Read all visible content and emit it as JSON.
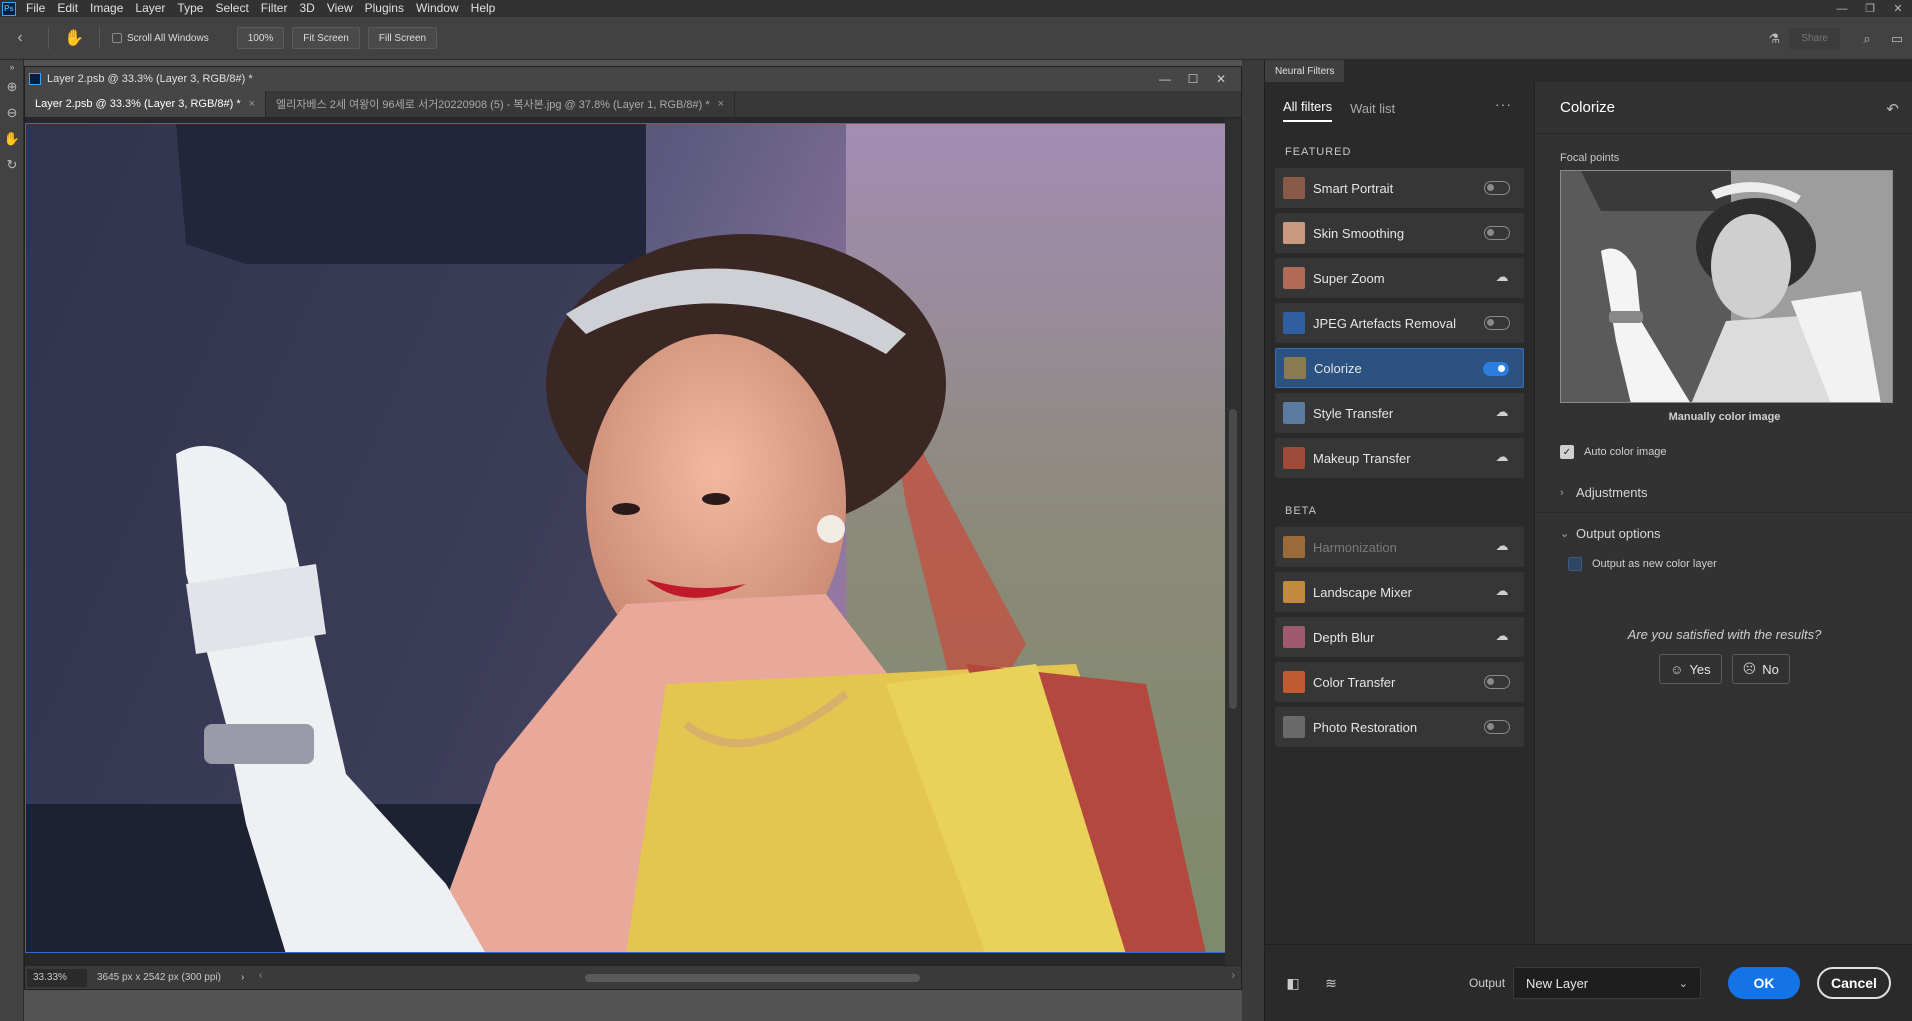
{
  "app": {
    "logo": "Ps",
    "menu": [
      "File",
      "Edit",
      "Image",
      "Layer",
      "Type",
      "Select",
      "Filter",
      "3D",
      "View",
      "Plugins",
      "Window",
      "Help"
    ]
  },
  "options_bar": {
    "scroll_all_windows": "Scroll All Windows",
    "zoom_100": "100%",
    "fit_screen": "Fit Screen",
    "fill_screen": "Fill Screen",
    "share": "Share"
  },
  "document": {
    "window_title": "Layer 2.psb @ 33.3% (Layer 3, RGB/8#) *",
    "tabs": [
      {
        "label": "Layer 2.psb @ 33.3% (Layer 3, RGB/8#) *",
        "close": "×"
      },
      {
        "label": "엘리자베스 2세 여왕이 96세로 서거20220908 (5) - 복사본.jpg @ 37.8% (Layer 1, RGB/8#) *",
        "close": "×"
      }
    ],
    "status_zoom": "33.33%",
    "status_dims": "3645 px x 2542 px (300 ppi)",
    "status_arrow": "›",
    "hscroll_left": "‹",
    "hscroll_right": "›"
  },
  "neural_filters": {
    "panel_tab": "Neural Filters",
    "list_tabs": {
      "all": "All filters",
      "wait": "Wait list"
    },
    "more": "···",
    "featured_title": "FEATURED",
    "beta_title": "BETA",
    "featured": [
      {
        "name": "Smart Portrait",
        "state": "off",
        "thumb": "#8a5a48"
      },
      {
        "name": "Skin Smoothing",
        "state": "off",
        "thumb": "#c99a80"
      },
      {
        "name": "Super Zoom",
        "state": "cloud",
        "thumb": "#b06a55"
      },
      {
        "name": "JPEG Artefacts Removal",
        "state": "off",
        "thumb": "#2f5fa0"
      },
      {
        "name": "Colorize",
        "state": "on",
        "thumb": "#8a7a50"
      },
      {
        "name": "Style Transfer",
        "state": "cloud",
        "thumb": "#5a7aa0"
      },
      {
        "name": "Makeup Transfer",
        "state": "cloud",
        "thumb": "#a04a3a"
      }
    ],
    "beta": [
      {
        "name": "Harmonization",
        "state": "cloud",
        "thumb": "#9a6a3a",
        "disabled": true
      },
      {
        "name": "Landscape Mixer",
        "state": "cloud",
        "thumb": "#c08a40"
      },
      {
        "name": "Depth Blur",
        "state": "cloud",
        "thumb": "#a05a70"
      },
      {
        "name": "Color Transfer",
        "state": "off",
        "thumb": "#c05a30"
      },
      {
        "name": "Photo Restoration",
        "state": "off",
        "thumb": "#6a6a6a"
      }
    ],
    "settings": {
      "title": "Colorize",
      "focal_points": "Focal points",
      "manual_label": "Manually color image",
      "auto_color": "Auto color image",
      "adjustments": "Adjustments",
      "output_options": "Output options",
      "output_new_layer": "Output as new color layer",
      "satisfied": "Are you satisfied with the results?",
      "yes": "Yes",
      "no": "No"
    },
    "footer": {
      "output_label": "Output",
      "output_value": "New Layer",
      "ok": "OK",
      "cancel": "Cancel"
    }
  }
}
